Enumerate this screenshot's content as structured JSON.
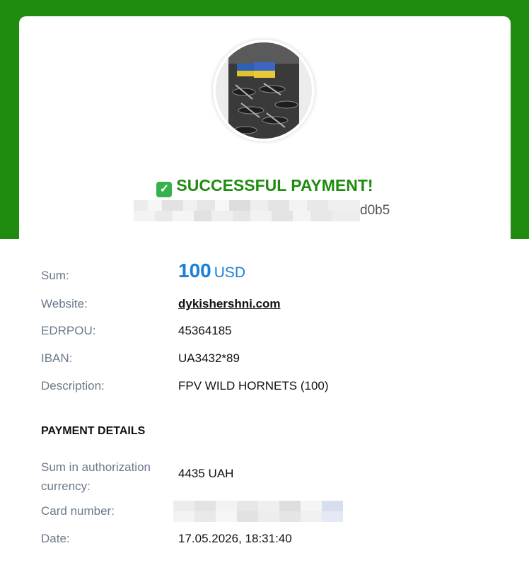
{
  "brand": {
    "header_color": "#1f8c0f",
    "accent_blue": "#1a7fd6"
  },
  "header": {
    "avatar_alt": "drone fleet with flag",
    "status_icon": "check-icon",
    "status_text": "SUCCESSFUL PAYMENT!",
    "order_id_suffix": "d0b5"
  },
  "summary": {
    "sum_label": "Sum:",
    "sum_amount": "100",
    "sum_currency": "USD",
    "website_label": "Website:",
    "website_value": "dykishershni.com",
    "edrpou_label": "EDRPOU:",
    "edrpou_value": "45364185",
    "iban_label": "IBAN:",
    "iban_value": "UA3432*89",
    "description_label": "Description:",
    "description_value": "FPV WILD HORNETS (100)"
  },
  "payment_details": {
    "title": "PAYMENT DETAILS",
    "auth_sum_label_line1": "Sum in authorization",
    "auth_sum_label_line2": "currency:",
    "auth_sum_value": "4435 UAH",
    "card_label": "Card number:",
    "date_label": "Date:",
    "date_value": "17.05.2026, 18:31:40"
  }
}
